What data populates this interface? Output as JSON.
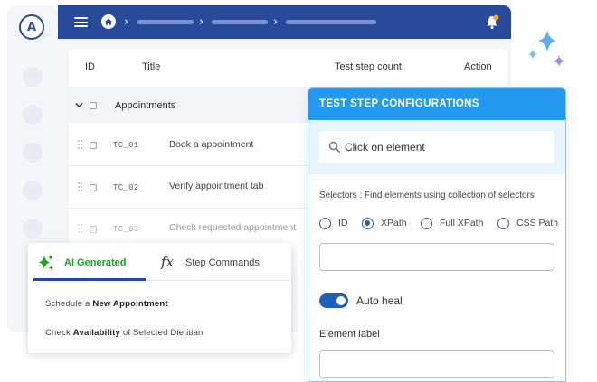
{
  "colors": {
    "topbar": "#294999",
    "config_header": "#239af0",
    "ai_accent": "#18a81f",
    "notification_badge": "#f5a623",
    "sparkle_blue": "#5aaef0",
    "sparkle_purple": "#a787e6"
  },
  "sidebar": {
    "logo_letter": "A"
  },
  "table": {
    "headers": {
      "id": "ID",
      "title": "Title",
      "count": "Test step count",
      "action": "Action"
    },
    "group": {
      "title": "Appointments"
    },
    "rows": [
      {
        "id": "TC_01",
        "title": "Book a appointment"
      },
      {
        "id": "TC_02",
        "title": "Verify appointment tab"
      },
      {
        "id": "TC_03",
        "title": "Check requested appointment"
      }
    ]
  },
  "config_panel": {
    "title": "TEST STEP CONFIGURATIONS",
    "search_value": "Click on element",
    "selectors_label": "Selectors : Find elements using collection of selectors",
    "radio_options": [
      "ID",
      "XPath",
      "Full XPath",
      "CSS Path"
    ],
    "selected_option": "XPath",
    "auto_heal_label": "Auto heal",
    "auto_heal_on": true,
    "element_label": "Element label"
  },
  "ai_panel": {
    "tabs": {
      "ai": "AI Generated",
      "commands": "Step Commands"
    },
    "suggestions": [
      {
        "pre": "Schedule a ",
        "bold": "New Appointment",
        "post": ""
      },
      {
        "pre": "Check ",
        "bold": "Availability",
        "post": " of Selected Dietitian"
      }
    ]
  }
}
